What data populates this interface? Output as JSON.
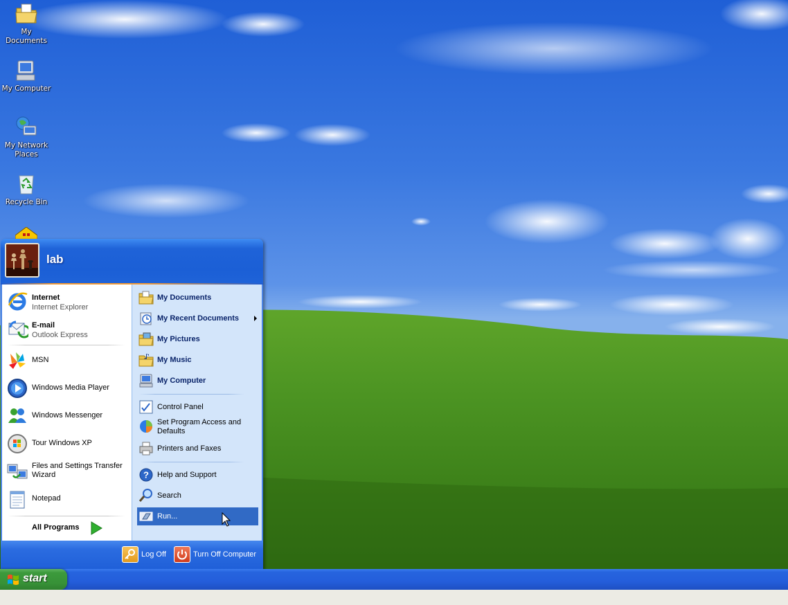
{
  "desktop": {
    "icons": [
      {
        "label": "My Documents",
        "icon": "my-documents-icon"
      },
      {
        "label": "My Computer",
        "icon": "my-computer-icon"
      },
      {
        "label": "My Network Places",
        "icon": "network-places-icon"
      },
      {
        "label": "Recycle Bin",
        "icon": "recycle-bin-icon"
      }
    ]
  },
  "start_menu": {
    "user_name": "lab",
    "pinned": [
      {
        "title": "Internet",
        "subtitle": "Internet Explorer",
        "icon": "internet-explorer-icon"
      },
      {
        "title": "E-mail",
        "subtitle": "Outlook Express",
        "icon": "outlook-express-icon"
      }
    ],
    "recent": [
      {
        "label": "MSN",
        "icon": "msn-icon"
      },
      {
        "label": "Windows Media Player",
        "icon": "media-player-icon"
      },
      {
        "label": "Windows Messenger",
        "icon": "messenger-icon"
      },
      {
        "label": "Tour Windows XP",
        "icon": "tour-icon"
      },
      {
        "label": "Files and Settings Transfer Wizard",
        "icon": "transfer-wizard-icon"
      },
      {
        "label": "Notepad",
        "icon": "notepad-icon"
      }
    ],
    "all_programs": "All Programs",
    "right": [
      {
        "label": "My Documents",
        "bold": true,
        "icon": "folder-icon"
      },
      {
        "label": "My Recent Documents",
        "bold": true,
        "submenu": true,
        "icon": "recent-documents-icon"
      },
      {
        "label": "My Pictures",
        "bold": true,
        "icon": "pictures-folder-icon"
      },
      {
        "label": "My Music",
        "bold": true,
        "icon": "music-folder-icon"
      },
      {
        "label": "My Computer",
        "bold": true,
        "icon": "computer-icon"
      },
      {
        "label": "Control Panel",
        "icon": "control-panel-icon"
      },
      {
        "label": "Set Program Access and Defaults",
        "icon": "program-access-icon"
      },
      {
        "label": "Printers and Faxes",
        "icon": "printer-icon"
      },
      {
        "label": "Help and Support",
        "icon": "help-icon"
      },
      {
        "label": "Search",
        "icon": "search-icon"
      },
      {
        "label": "Run...",
        "icon": "run-icon",
        "highlighted": true
      }
    ],
    "footer": {
      "log_off": "Log Off",
      "turn_off": "Turn Off Computer"
    }
  },
  "taskbar": {
    "start_label": "start"
  }
}
